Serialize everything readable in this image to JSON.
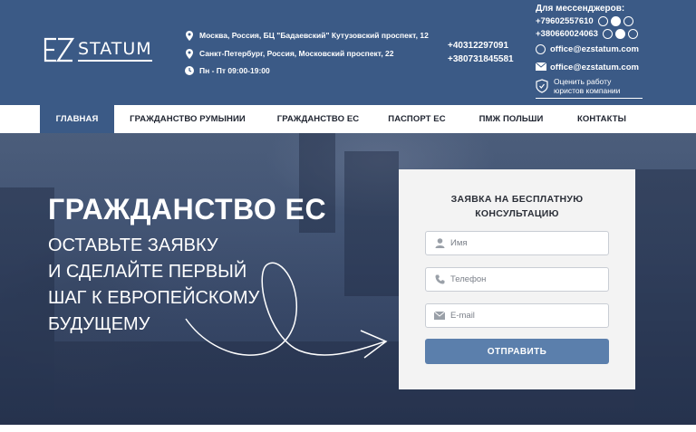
{
  "header": {
    "logo_text": "STATUM",
    "addresses": [
      "Москва, Россия, БЦ \"Бадаевский\" Кутузовский проспект, 12",
      "Санкт-Петербург, Россия, Московский проспект, 22"
    ],
    "hours": "Пн - Пт 09:00-19:00",
    "phones": [
      "+40312297091",
      "+380731845581"
    ],
    "messengers_title": "Для мессенджеров:",
    "messenger_phones": [
      "+79602557610",
      "+380660024063"
    ],
    "skype_email": "office@ezstatum.com",
    "email": "office@ezstatum.com",
    "rate_text": "Оценить работу юристов компании"
  },
  "nav": {
    "items": [
      {
        "label": "ГЛАВНАЯ",
        "active": true
      },
      {
        "label": "ГРАЖДАНСТВО РУМЫНИИ",
        "active": false
      },
      {
        "label": "ГРАЖДАНСТВО ЕС",
        "active": false
      },
      {
        "label": "ПАСПОРТ ЕС",
        "active": false
      },
      {
        "label": "ПМЖ ПОЛЬШИ",
        "active": false
      },
      {
        "label": "КОНТАКТЫ",
        "active": false
      }
    ]
  },
  "hero": {
    "title": "ГРАЖДАНСТВО ЕС",
    "subtitle_lines": [
      "ОСТАВЬТЕ ЗАЯВКУ",
      "И СДЕЛАЙТЕ ПЕРВЫЙ",
      "ШАГ К ЕВРОПЕЙСКОМУ",
      "БУДУЩЕМУ"
    ]
  },
  "form": {
    "title_line1": "ЗАЯВКА НА БЕСПЛАТНУЮ",
    "title_line2": "КОНСУЛЬТАЦИЮ",
    "name_placeholder": "Имя",
    "phone_placeholder": "Телефон",
    "email_placeholder": "E-mail",
    "submit_label": "ОТПРАВИТЬ"
  },
  "colors": {
    "header_bg": "#3b5a86",
    "button_bg": "#5b7fac",
    "form_bg": "#f3f3f3"
  }
}
